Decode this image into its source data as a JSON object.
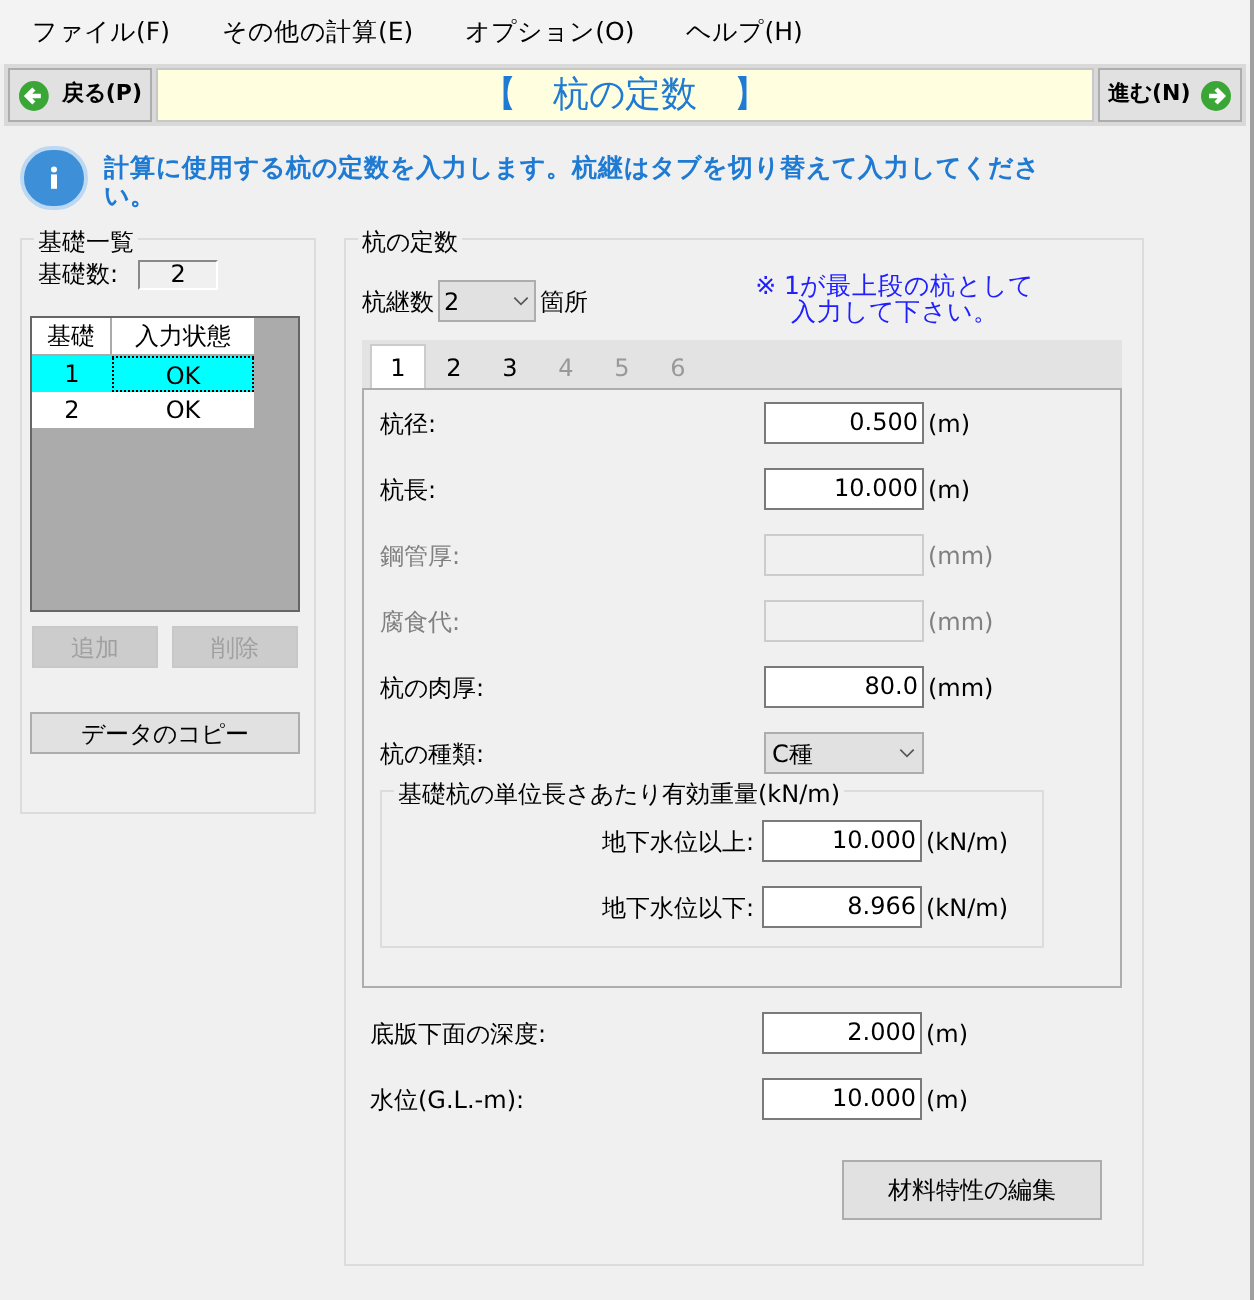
{
  "menu": [
    {
      "label": "ファイル(F)"
    },
    {
      "label": "その他の計算(E)"
    },
    {
      "label": "オプション(O)"
    },
    {
      "label": "ヘルプ(H)"
    }
  ],
  "nav": {
    "back": "戻る(P)",
    "title": "【　杭の定数　】",
    "next": "進む(N)"
  },
  "info": "計算に使用する杭の定数を入力します。杭継はタブを切り替えて入力してください。",
  "foundation_list": {
    "title": "基礎一覧",
    "count_label": "基礎数:",
    "count": "2",
    "columns": [
      "基礎",
      "入力状態"
    ],
    "rows": [
      {
        "cells": [
          "1",
          "OK"
        ],
        "selected": true
      },
      {
        "cells": [
          "2",
          "OK"
        ],
        "selected": false
      }
    ],
    "buttons": [
      {
        "label": "追加",
        "disabled": true
      },
      {
        "label": "削除",
        "disabled": true
      }
    ],
    "copy_button": "データのコピー"
  },
  "pile": {
    "title": "杭の定数",
    "joint_label": "杭継数",
    "joint_value": "2",
    "joint_unit": "箇所",
    "note": [
      "※ 1が最上段の杭として",
      "入力して下さい。"
    ],
    "tabs": [
      {
        "label": "1",
        "selected": true,
        "disabled": false
      },
      {
        "label": "2",
        "selected": false,
        "disabled": false
      },
      {
        "label": "3",
        "selected": false,
        "disabled": false
      },
      {
        "label": "4",
        "selected": false,
        "disabled": true
      },
      {
        "label": "5",
        "selected": false,
        "disabled": true
      },
      {
        "label": "6",
        "selected": false,
        "disabled": true
      }
    ],
    "fields": [
      {
        "kind": "input",
        "label": "杭径:",
        "value": "0.500",
        "unit": "(m)",
        "disabled": false
      },
      {
        "kind": "input",
        "label": "杭長:",
        "value": "10.000",
        "unit": "(m)",
        "disabled": false
      },
      {
        "kind": "input",
        "label": "鋼管厚:",
        "unit": "(mm)",
        "disabled": true
      },
      {
        "kind": "input",
        "label": "腐食代:",
        "unit": "(mm)",
        "disabled": true
      },
      {
        "kind": "input",
        "label": "杭の肉厚:",
        "value": "80.0",
        "unit": "(mm)",
        "disabled": false
      },
      {
        "kind": "select",
        "label": "杭の種類:",
        "value": "C種"
      }
    ],
    "weight": {
      "title": "基礎杭の単位長さあたり有効重量(kN/m)",
      "fields": [
        {
          "label": "地下水位以上:",
          "value": "10.000",
          "unit": "(kN/m)"
        },
        {
          "label": "地下水位以下:",
          "value": "8.966",
          "unit": "(kN/m)"
        }
      ]
    },
    "bottom_fields": [
      {
        "label": "底版下面の深度:",
        "value": "2.000",
        "unit": "(m)"
      },
      {
        "label": "水位(G.L.-m):",
        "value": "10.000",
        "unit": "(m)"
      }
    ],
    "edit_button": "材料特性の編集"
  }
}
